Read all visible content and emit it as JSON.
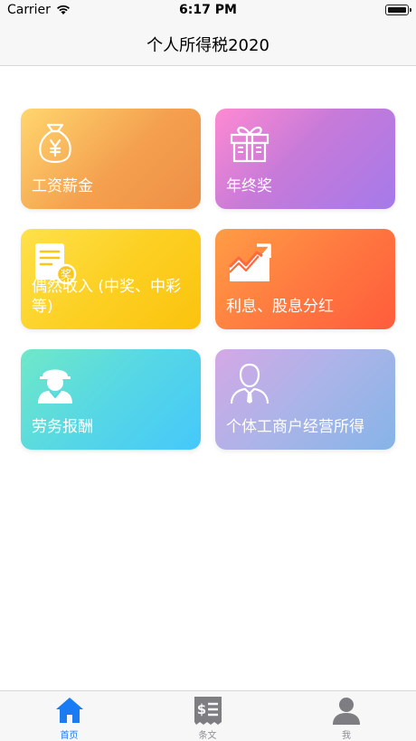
{
  "status_bar": {
    "carrier": "Carrier",
    "time": "6:17 PM"
  },
  "nav": {
    "title": "个人所得税2020"
  },
  "cards": [
    {
      "label": "工资薪金",
      "icon": "money-bag-icon"
    },
    {
      "label": "年终奖",
      "icon": "gift-box-icon"
    },
    {
      "label": "偶然收入 (中奖、中彩等)",
      "icon": "prize-document-icon"
    },
    {
      "label": "利息、股息分红",
      "icon": "trend-chart-icon"
    },
    {
      "label": "劳务报酬",
      "icon": "worker-icon"
    },
    {
      "label": "个体工商户经营所得",
      "icon": "businessman-icon"
    }
  ],
  "tabs": [
    {
      "label": "首页",
      "icon": "home-icon",
      "active": true
    },
    {
      "label": "条文",
      "icon": "receipt-icon",
      "active": false
    },
    {
      "label": "我",
      "icon": "user-icon",
      "active": false
    }
  ],
  "colors": {
    "tab_active": "#1a7cf5",
    "tab_inactive": "#8e8e93",
    "card_1": "#f4a04e",
    "card_2": "#b77ae2",
    "card_3": "#fcd023",
    "card_4": "#ff7240",
    "card_5": "#56d7e5",
    "card_6": "#aab4e8"
  }
}
